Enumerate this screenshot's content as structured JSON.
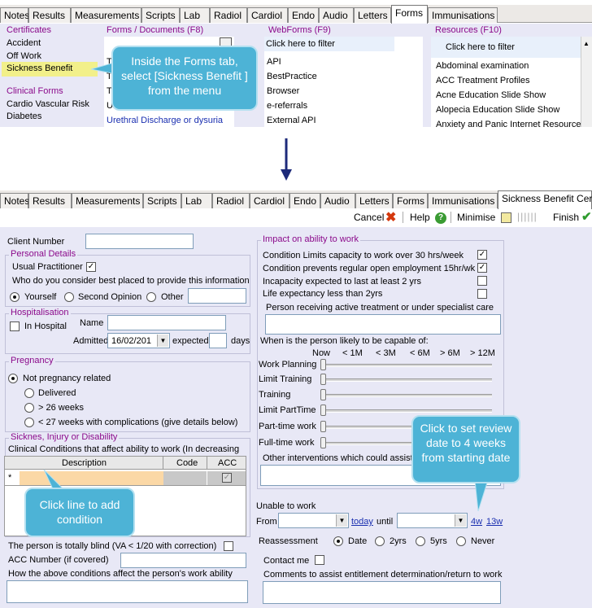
{
  "top_tabs": [
    "Notes",
    "Results",
    "Measurements",
    "Scripts",
    "Lab",
    "Radiol",
    "Cardiol",
    "Endo",
    "Audio",
    "Letters",
    "Forms",
    "Immunisations"
  ],
  "bottom_tabs": [
    "Notes",
    "Results",
    "Measurements",
    "Scripts",
    "Lab",
    "Radiol",
    "Cardiol",
    "Endo",
    "Audio",
    "Letters",
    "Forms",
    "Immunisations",
    "Sickness Benefit Cert"
  ],
  "certificates": {
    "title": "Certificates",
    "items": [
      "Accident",
      "Off Work",
      "Sickness Benefit"
    ]
  },
  "clinical_forms": {
    "title": "Clinical Forms",
    "items": [
      "Cardio Vascular Risk",
      "Diabetes"
    ]
  },
  "forms_docs": {
    "title": "Forms / Documents (F8)",
    "items": [
      "Tr",
      "Tr",
      "Tr",
      "U2",
      "Urethral Discharge or dysuria"
    ]
  },
  "webforms": {
    "title": "WebForms (F9)",
    "filter": "Click here to filter",
    "items": [
      "API",
      "BestPractice",
      "Browser",
      "e-referrals",
      "External API"
    ]
  },
  "resources": {
    "title": "Resources (F10)",
    "filter": "Click here to filter",
    "items": [
      "Abdominal examination",
      "ACC Treatment Profiles",
      "Acne Education Slide Show",
      "Alopecia Education Slide Show",
      "Anxiety and Panic Internet Resource"
    ]
  },
  "callouts": {
    "select": "Inside the Forms tab, select [Sickness Benefit ] from the menu",
    "add": "Click line to add condition",
    "review": "Click to set review date to 4 weeks from starting date"
  },
  "toolbar": {
    "cancel": "Cancel",
    "help": "Help",
    "minimise": "Minimise",
    "finish": "Finish"
  },
  "form": {
    "client_number": "Client Number",
    "personal_details": "Personal Details",
    "usual_practitioner": "Usual Practitioner",
    "who_best": "Who do you consider best placed to provide this information",
    "yourself": "Yourself",
    "second_opinion": "Second Opinion",
    "other": "Other",
    "hospitalisation": "Hospitalisation",
    "in_hospital": "In Hospital",
    "name": "Name",
    "admitted": "Admitted",
    "admitted_date": "16/02/201",
    "expected": "expected",
    "days": "days",
    "pregnancy": "Pregnancy",
    "preg_options": [
      "Not pregnancy related",
      "Delivered",
      "> 26 weeks",
      "< 27 weeks with complications (give details below)"
    ],
    "sickness": "Sicknes, Injury or Disability",
    "clinical_conditions": "Clinical Conditions that affect ability to  work (In decreasing",
    "columns": [
      "Description",
      "Code",
      "ACC"
    ],
    "row_marker": "*",
    "blind": "The person is totally blind (VA < 1/20 with correction)",
    "acc_number": "ACC Number (if covered)",
    "how_affect": "How the above conditions affect the person's  work ability"
  },
  "impact": {
    "title": "Impact on ability to work",
    "items": [
      {
        "label": "Condition Limits capacity to  work over 30 hrs/week",
        "checked": true
      },
      {
        "label": "Condition prevents regular open employment 15hr/wk",
        "checked": true
      },
      {
        "label": "Incapacity expected to last at least 2 yrs",
        "checked": false
      },
      {
        "label": "Life expectancy less than 2yrs",
        "checked": false
      }
    ],
    "active_treatment": "Person receiving active treatment or under specialist care",
    "when_capable": "When is the person likely to be capable of:",
    "time_cols": [
      "Now",
      "< 1M",
      "< 3M",
      "< 6M",
      "> 6M",
      "> 12M"
    ],
    "sliders": [
      "Work Planning",
      "Limit Training",
      "Training",
      "Limit PartTime",
      "Part-time work",
      "Full-time work"
    ],
    "other_interventions": "Other interventions which could assist",
    "unable": "Unable to work",
    "from": "From",
    "today": "today",
    "until": "until",
    "w4": "4w",
    "w13": "13w",
    "reassessment": "Reassessment",
    "reassess_opts": [
      "Date",
      "2yrs",
      "5yrs",
      "Never"
    ],
    "contact_me": "Contact me",
    "comments": "Comments to assist entitlement determination/return to work"
  }
}
